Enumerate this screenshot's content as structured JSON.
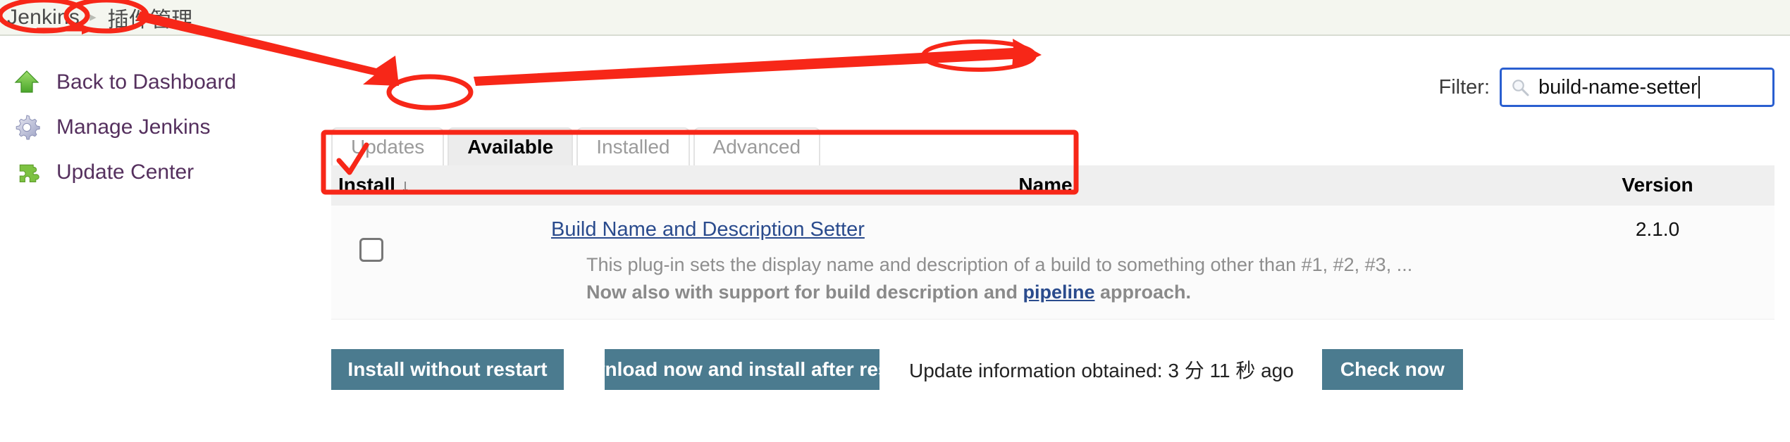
{
  "breadcrumb": {
    "root": "Jenkins",
    "separator": "▸",
    "current": "插件管理"
  },
  "sidebar": {
    "items": [
      {
        "label": "Back to Dashboard",
        "icon": "up-arrow-icon"
      },
      {
        "label": "Manage Jenkins",
        "icon": "gear-icon"
      },
      {
        "label": "Update Center",
        "icon": "puzzle-piece-icon"
      }
    ]
  },
  "filter": {
    "label": "Filter:",
    "value": "build-name-setter",
    "placeholder": "",
    "icon": "search-icon"
  },
  "tabs": [
    {
      "label": "Updates",
      "active": false
    },
    {
      "label": "Available",
      "active": true
    },
    {
      "label": "Installed",
      "active": false
    },
    {
      "label": "Advanced",
      "active": false
    }
  ],
  "table": {
    "headers": {
      "install": "Install",
      "sort_arrow": "↓",
      "name": "Name",
      "version": "Version"
    },
    "rows": [
      {
        "checked": false,
        "name": "Build Name and Description Setter",
        "description_line1": "This plug-in sets the display name and description of a build to something other than #1, #2, #3, ...",
        "description_line2_pre": "Now also with support for build description and ",
        "description_line2_link": "pipeline",
        "description_line2_post": " approach.",
        "version": "2.1.0"
      }
    ]
  },
  "buttons": {
    "install_without_restart": "Install without restart",
    "download_install_after_restart": "Download now and install after restart",
    "check_now": "Check now"
  },
  "status": {
    "update_info": "Update information obtained: 3 分 11 秒 ago"
  },
  "colors": {
    "accent_button": "#4b7b8f",
    "annotation": "#f72718",
    "link": "#2a4b8d",
    "sidebar_link": "#55305e",
    "focus_border": "#2a5fd0",
    "breadcrumb_bg": "#f4f6ef",
    "table_header_bg": "#efefef",
    "tab_active_bg": "#ececec"
  }
}
